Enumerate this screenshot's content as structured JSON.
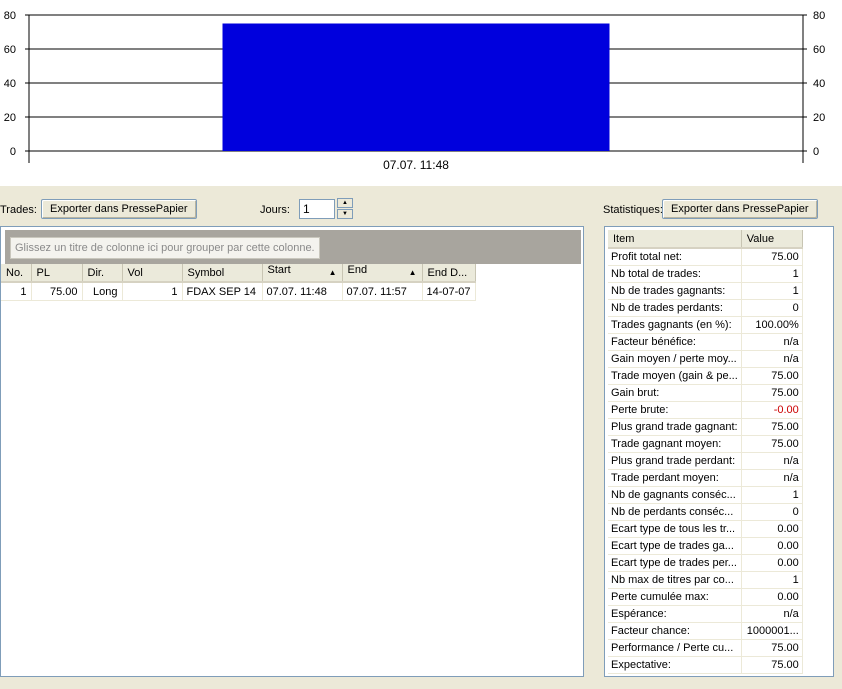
{
  "chart_data": {
    "type": "bar",
    "categories": [
      "07.07. 11:48"
    ],
    "values": [
      75
    ],
    "ylim": [
      0,
      80
    ],
    "yticks": [
      0,
      20,
      40,
      60,
      80
    ],
    "grid": true,
    "bar_color": "#0000DD",
    "tick_label_sides": "left-and-right"
  },
  "trades": {
    "label": "Trades:",
    "export_label": "Exporter dans PressePapier",
    "days_label": "Jours:",
    "days_value": "1",
    "group_hint": "Glissez un titre de colonne ici pour grouper par cette colonne.",
    "columns": [
      "No.",
      "PL",
      "Dir.",
      "Vol",
      "Symbol",
      "Start",
      "End",
      "End D..."
    ],
    "rows": [
      [
        "1",
        "75.00",
        "Long",
        "1",
        "FDAX SEP 14",
        "07.07. 11:48",
        "07.07. 11:57",
        "14-07-07"
      ]
    ]
  },
  "stats": {
    "label": "Statistiques:",
    "export_label": "Exporter dans PressePapier",
    "columns": [
      "Item",
      "Value"
    ],
    "rows": [
      [
        "Profit total net:",
        "75.00"
      ],
      [
        "Nb total de trades:",
        "1"
      ],
      [
        "Nb de trades gagnants:",
        "1"
      ],
      [
        "Nb de trades perdants:",
        "0"
      ],
      [
        "Trades gagnants (en %):",
        "100.00%"
      ],
      [
        "Facteur bénéfice:",
        "n/a"
      ],
      [
        "Gain moyen / perte moy...",
        "n/a"
      ],
      [
        "Trade moyen (gain & pe...",
        "75.00"
      ],
      [
        "Gain brut:",
        "75.00"
      ],
      [
        "Perte brute:",
        "-0.00"
      ],
      [
        "Plus grand trade gagnant:",
        "75.00"
      ],
      [
        "Trade gagnant moyen:",
        "75.00"
      ],
      [
        "Plus grand trade perdant:",
        "n/a"
      ],
      [
        "Trade perdant moyen:",
        "n/a"
      ],
      [
        "Nb de gagnants conséc...",
        "1"
      ],
      [
        "Nb de perdants conséc...",
        "0"
      ],
      [
        "Ecart type de tous les tr...",
        "0.00"
      ],
      [
        "Ecart type de trades ga...",
        "0.00"
      ],
      [
        "Ecart type de trades per...",
        "0.00"
      ],
      [
        "Nb max de titres par co...",
        "1"
      ],
      [
        "Perte cumulée max:",
        "0.00"
      ],
      [
        "Espérance:",
        "n/a"
      ],
      [
        "Facteur chance:",
        "1000001..."
      ],
      [
        "Performance / Perte cu...",
        "75.00"
      ],
      [
        "Expectative:",
        "75.00"
      ]
    ],
    "negative_color": "#CC0000"
  }
}
